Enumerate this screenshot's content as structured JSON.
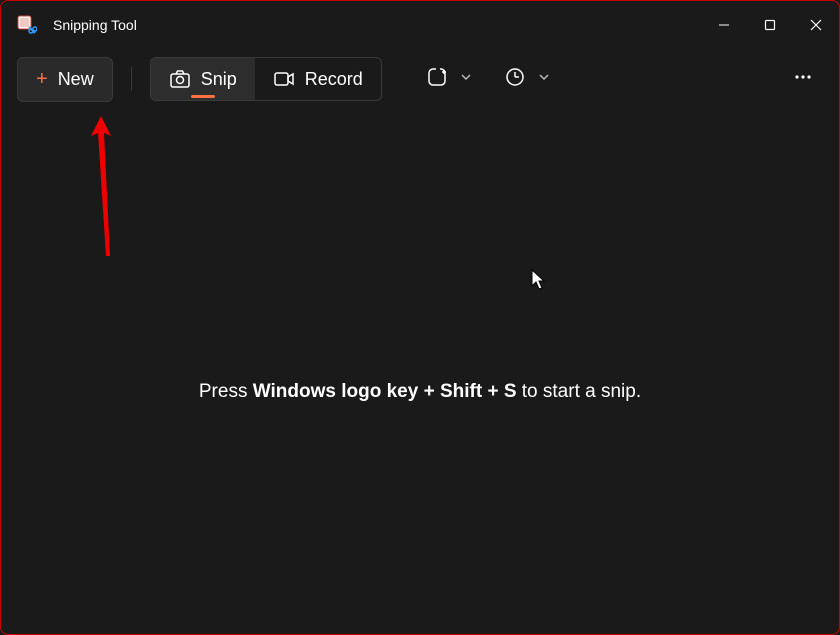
{
  "app": {
    "title": "Snipping Tool"
  },
  "toolbar": {
    "new_label": "New",
    "snip_label": "Snip",
    "record_label": "Record"
  },
  "hint": {
    "prefix": "Press ",
    "keys": "Windows logo key + Shift + S",
    "suffix": " to start a snip."
  }
}
